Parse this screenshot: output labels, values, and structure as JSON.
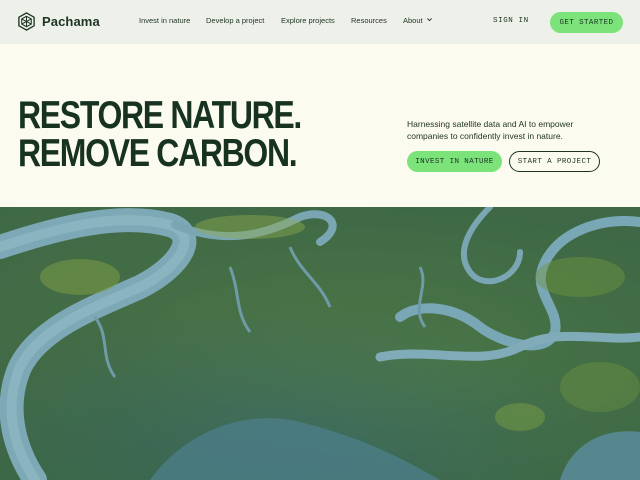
{
  "brand": {
    "name": "Pachama",
    "logo_icon": "hexagon-leaf-icon"
  },
  "nav": {
    "items": [
      {
        "label": "Invest in nature"
      },
      {
        "label": "Develop a project"
      },
      {
        "label": "Explore projects"
      },
      {
        "label": "Resources"
      },
      {
        "label": "About"
      }
    ],
    "sign_in": "SIGN IN",
    "get_started": "GET STARTED"
  },
  "hero": {
    "headline_line1": "RESTORE NATURE.",
    "headline_line2": "REMOVE CARBON.",
    "subtext": "Harnessing satellite data and AI to empower companies to confidently invest in nature.",
    "primary_cta": "INVEST IN NATURE",
    "secondary_cta": "START A PROJECT"
  },
  "colors": {
    "background": "#fcfbef",
    "header": "#eef0ea",
    "accent_green": "#7be37a",
    "text_dark": "#1d3323",
    "water": "#6f9fb0",
    "marsh": "#4f7a3a"
  }
}
